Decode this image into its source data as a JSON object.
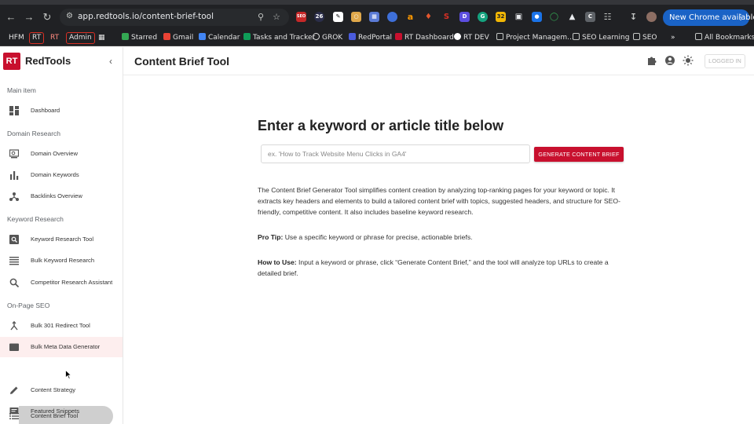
{
  "browser": {
    "url": "app.redtools.io/content-brief-tool",
    "new_chrome_label": "New Chrome available",
    "bookmarks": [
      {
        "label": "HFM"
      },
      {
        "label": "RT"
      },
      {
        "label": "RT"
      },
      {
        "label": "Admin"
      },
      {
        "label": "Starred"
      },
      {
        "label": "Gmail"
      },
      {
        "label": "Calendar"
      },
      {
        "label": "Tasks and Tracker"
      },
      {
        "label": "GROK"
      },
      {
        "label": "RedPortal"
      },
      {
        "label": "RT Dashboard"
      },
      {
        "label": "RT DEV"
      },
      {
        "label": "Project Managem..."
      },
      {
        "label": "SEO Learning"
      },
      {
        "label": "SEO"
      },
      {
        "label": "All Bookmarks"
      }
    ],
    "extensions": [
      "SEO",
      "26",
      "32",
      "C"
    ]
  },
  "sidebar": {
    "logo_mark": "RT",
    "app_name": "RedTools",
    "sections": [
      {
        "title": "Main item"
      },
      {
        "title": "Domain Research"
      },
      {
        "title": "Keyword Research"
      },
      {
        "title": "On-Page SEO"
      }
    ],
    "items": [
      {
        "label": "Dashboard"
      },
      {
        "label": "Domain Overview"
      },
      {
        "label": "Domain Keywords"
      },
      {
        "label": "Backlinks Overview"
      },
      {
        "label": "Keyword Research Tool"
      },
      {
        "label": "Bulk Keyword Research"
      },
      {
        "label": "Competitor Research Assistant"
      },
      {
        "label": "Bulk 301 Redirect Tool"
      },
      {
        "label": "Bulk Meta Data Generator"
      },
      {
        "label": "Content Brief Tool"
      },
      {
        "label": "Content Strategy"
      },
      {
        "label": "Featured Snippets"
      }
    ]
  },
  "header": {
    "title": "Content Brief Tool",
    "login_label": "LOGGED IN"
  },
  "main": {
    "heading": "Enter a keyword or article title below",
    "input_placeholder": "ex. 'How to Track Website Menu Clicks in GA4'",
    "button_label": "GENERATE CONTENT BRIEF",
    "description": "The Content Brief Generator Tool simplifies content creation by analyzing top-ranking pages for your keyword or topic. It extracts key headers and elements to build a tailored content brief with topics, suggested headers, and structure for SEO-friendly, competitive content. It also includes baseline keyword research.",
    "pro_tip_label": "Pro Tip:",
    "pro_tip_text": " Use a specific keyword or phrase for precise, actionable briefs.",
    "how_to_label": "How to Use:",
    "how_to_text": " Input a keyword or phrase, click “Generate Content Brief,” and the tool will analyze top URLs to create a detailed brief."
  },
  "colors": {
    "brand": "#c8102e",
    "active_item": "#cfcfcf",
    "hover_item": "#fdeeee"
  }
}
